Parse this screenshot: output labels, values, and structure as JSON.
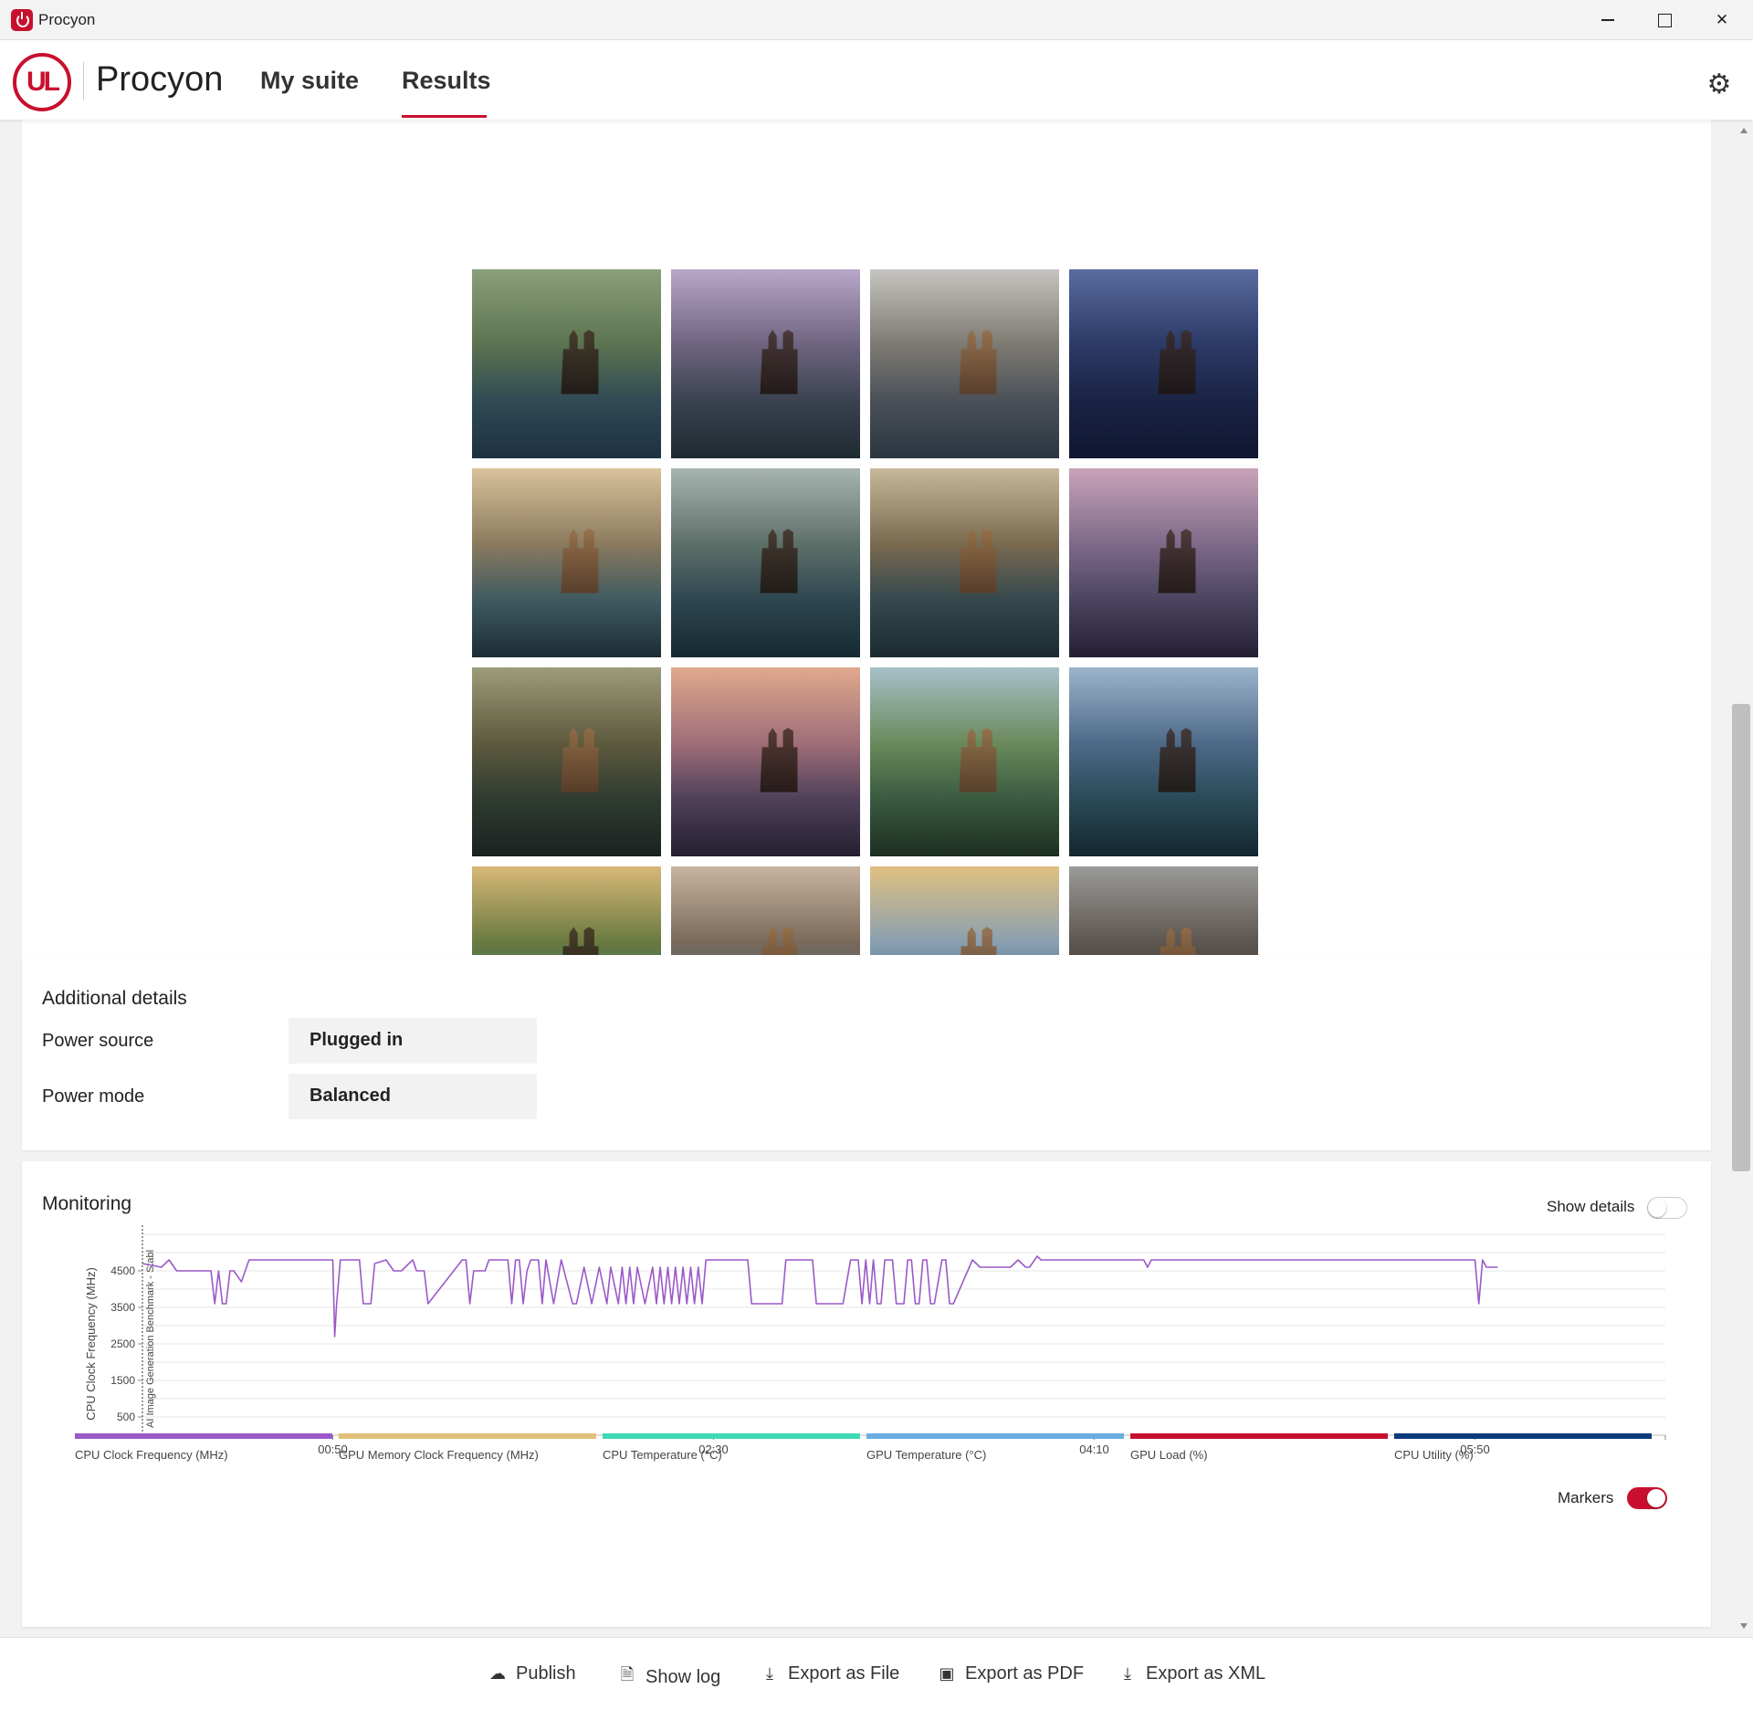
{
  "window": {
    "title": "Procyon"
  },
  "header": {
    "brand": "Procyon",
    "logo_text": "UL",
    "tabs": [
      {
        "label": "My suite"
      },
      {
        "label": "Results"
      }
    ],
    "active_tab": "Results"
  },
  "gallery": {
    "images": [
      {
        "name": "castle-image-1"
      },
      {
        "name": "castle-image-2"
      },
      {
        "name": "castle-image-3"
      },
      {
        "name": "castle-image-4"
      },
      {
        "name": "castle-image-5"
      },
      {
        "name": "castle-image-6"
      },
      {
        "name": "castle-image-7"
      },
      {
        "name": "castle-image-8"
      },
      {
        "name": "castle-image-9"
      },
      {
        "name": "castle-image-10"
      },
      {
        "name": "castle-image-11"
      },
      {
        "name": "castle-image-12"
      },
      {
        "name": "castle-image-13"
      },
      {
        "name": "castle-image-14"
      },
      {
        "name": "castle-image-15"
      },
      {
        "name": "castle-image-16"
      }
    ]
  },
  "details": {
    "title": "Additional details",
    "rows": [
      {
        "label": "Power source",
        "value": "Plugged in"
      },
      {
        "label": "Power mode",
        "value": "Balanced"
      }
    ]
  },
  "monitoring": {
    "title": "Monitoring",
    "show_details_label": "Show details",
    "show_details_on": false,
    "markers_label": "Markers",
    "markers_on": true,
    "marker_text": "AI Image Generation Benchmark - Stabl",
    "legend": [
      {
        "label": "CPU Clock Frequency (MHz)",
        "color": "#9b59c8"
      },
      {
        "label": "GPU Memory Clock Frequency (MHz)",
        "color": "#e0c07a"
      },
      {
        "label": "CPU Temperature (°C)",
        "color": "#3ddbb5"
      },
      {
        "label": "GPU Temperature (°C)",
        "color": "#6aaee0"
      },
      {
        "label": "GPU Load (%)",
        "color": "#c8102e"
      },
      {
        "label": "CPU Utility (%)",
        "color": "#0a3b7a"
      }
    ]
  },
  "chart_data": {
    "type": "line",
    "ylabel": "CPU Clock Frequency (MHz)",
    "y_ticks": [
      500,
      1500,
      2500,
      3500,
      4500
    ],
    "ylim": [
      0,
      5500
    ],
    "xlim": [
      0,
      400
    ],
    "x_ticks": [
      {
        "value": 50,
        "label": "00:50"
      },
      {
        "value": 150,
        "label": "02:30"
      },
      {
        "value": 250,
        "label": "04:10"
      },
      {
        "value": 350,
        "label": "05:50"
      }
    ],
    "grid": true,
    "series": [
      {
        "name": "CPU Clock Frequency (MHz)",
        "color": "#9b59c8",
        "x": [
          0,
          5,
          7,
          9,
          10,
          18,
          19,
          20,
          21,
          22,
          23,
          24,
          26,
          28,
          50,
          50.5,
          51,
          52,
          57,
          58,
          60,
          61,
          64,
          66,
          68,
          71,
          72,
          74,
          75,
          84,
          85,
          86,
          87,
          90,
          91,
          96,
          97,
          98,
          99,
          100,
          101,
          102,
          104,
          105,
          106,
          108,
          110,
          113,
          114,
          116,
          118,
          120,
          122,
          123,
          125,
          126,
          127,
          128,
          129,
          130,
          132,
          134,
          135,
          136,
          137,
          138,
          139,
          140,
          141,
          142,
          143,
          144,
          145,
          146,
          147,
          148,
          149,
          150,
          151,
          152,
          159,
          160,
          161,
          167,
          168,
          169,
          175,
          176,
          177,
          178,
          184,
          186,
          187,
          188,
          189,
          190,
          191,
          192,
          193,
          194,
          195,
          196,
          197,
          198,
          200,
          201,
          202,
          203,
          204,
          205,
          206,
          207,
          208,
          210,
          211,
          212,
          213,
          218,
          220,
          222,
          228,
          230,
          232,
          233,
          235,
          236,
          262,
          263,
          264,
          265,
          350,
          351,
          352,
          353,
          354,
          356
        ],
        "y": [
          4700,
          4600,
          4800,
          4500,
          4500,
          4500,
          3600,
          4500,
          3600,
          3600,
          4500,
          4500,
          4200,
          4800,
          4800,
          2700,
          3600,
          4800,
          4800,
          3600,
          3600,
          4700,
          4800,
          4500,
          4500,
          4800,
          4500,
          4500,
          3600,
          4800,
          4800,
          3600,
          4500,
          4500,
          4800,
          4800,
          3600,
          4800,
          4800,
          3600,
          4500,
          4800,
          4800,
          3600,
          4800,
          3600,
          4800,
          3600,
          3600,
          4600,
          3600,
          4600,
          3600,
          4600,
          3600,
          4600,
          3600,
          4600,
          3600,
          4600,
          3600,
          4600,
          3600,
          4600,
          3600,
          4600,
          3600,
          4600,
          3600,
          4600,
          3600,
          4600,
          3600,
          4600,
          3600,
          4800,
          4800,
          4800,
          4800,
          4800,
          4800,
          3600,
          3600,
          3600,
          3600,
          4800,
          4800,
          4800,
          3600,
          3600,
          3600,
          4800,
          4800,
          4800,
          3600,
          4800,
          3600,
          4800,
          3600,
          3600,
          4800,
          4800,
          4800,
          3600,
          3600,
          4800,
          4800,
          3600,
          3600,
          4800,
          4800,
          3600,
          3600,
          4800,
          4800,
          3600,
          3600,
          4800,
          4600,
          4600,
          4600,
          4800,
          4600,
          4600,
          4900,
          4800,
          4800,
          4800,
          4600,
          4800,
          4800,
          3600,
          4800,
          4600,
          4600,
          4600
        ]
      }
    ]
  },
  "footer": {
    "actions": [
      {
        "label": "Publish",
        "icon": "cloud-upload-icon"
      },
      {
        "label": "Show log",
        "icon": "document-icon"
      },
      {
        "label": "Export as File",
        "icon": "download-icon"
      },
      {
        "label": "Export as PDF",
        "icon": "save-icon"
      },
      {
        "label": "Export as XML",
        "icon": "download-icon"
      }
    ]
  }
}
